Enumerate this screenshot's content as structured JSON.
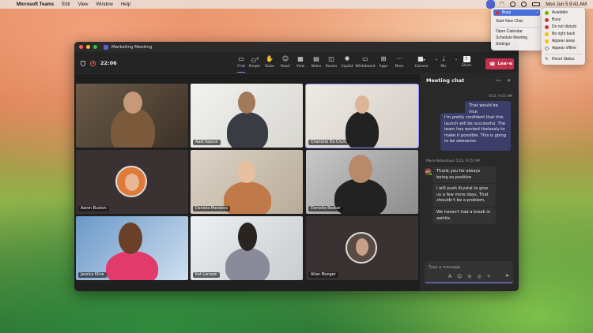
{
  "menubar": {
    "app": "Microsoft Teams",
    "items": [
      "Edit",
      "View",
      "Window",
      "Help"
    ],
    "clock": "Mon Jun 5  9:41 AM"
  },
  "window": {
    "title": "Marketing Meeting",
    "timer": "22:06"
  },
  "toolbar": {
    "buttons": [
      {
        "label": "Chat",
        "icon": "chat-icon",
        "glyph": "💬"
      },
      {
        "label": "People",
        "icon": "people-icon",
        "glyph": "👥",
        "badge": "9"
      },
      {
        "label": "Raise",
        "icon": "raise-hand-icon",
        "glyph": "✋"
      },
      {
        "label": "React",
        "icon": "react-icon",
        "glyph": "☺"
      },
      {
        "label": "View",
        "icon": "view-icon",
        "glyph": "▦"
      },
      {
        "label": "Notes",
        "icon": "notes-icon",
        "glyph": "▤"
      },
      {
        "label": "Rooms",
        "icon": "rooms-icon",
        "glyph": "◫"
      },
      {
        "label": "Copilot",
        "icon": "copilot-icon",
        "glyph": "✺"
      },
      {
        "label": "Whiteboard",
        "icon": "whiteboard-icon",
        "glyph": "▭"
      },
      {
        "label": "Apps",
        "icon": "apps-icon",
        "glyph": "⊞"
      },
      {
        "label": "More",
        "icon": "more-icon",
        "glyph": "···"
      },
      {
        "label": "Camera",
        "icon": "camera-icon",
        "glyph": "■"
      },
      {
        "label": "Mic",
        "icon": "mic-icon",
        "glyph": "🎙"
      },
      {
        "label": "Share",
        "icon": "share-icon",
        "glyph": "⇧"
      }
    ],
    "leave_label": "Leave"
  },
  "participants": [
    {
      "name": ""
    },
    {
      "name": "Aadi Kapoor"
    },
    {
      "name": "Charlotte De Crum"
    },
    {
      "name": "Aaron Buxton"
    },
    {
      "name": "Daniela Mandera"
    },
    {
      "name": "Danielle Booker"
    },
    {
      "name": "Jessica Kline"
    },
    {
      "name": "Kat Larsson"
    },
    {
      "name": "Allan Munger"
    }
  ],
  "chat": {
    "title": "Meeting chat",
    "messages": [
      {
        "timestamp": "5/12, 9:15 AM",
        "text": "That would be nice"
      },
      {
        "text": "I'm pretty confident that this launch will be successful. The team has worked tirelessly to make it possible. This is going to be awesome."
      },
      {
        "sender": "Marie Beaudouin",
        "timestamp": "5/12, 9:15 AM",
        "initials": "MB",
        "text": "Thank you for always being so positive"
      },
      {
        "text": "I will push Krystal to give us a few more days. That shouldn't be a problem."
      },
      {
        "text": "We haven't had a break in awhile."
      }
    ],
    "compose_placeholder": "Type a message"
  },
  "presence_menu": {
    "current": "Busy",
    "items": [
      "Start New Chat",
      "Open Calendar",
      "Schedule Meeting",
      "Settings"
    ]
  },
  "status_menu": {
    "options": [
      {
        "label": "Available",
        "color": "#6bb700"
      },
      {
        "label": "Busy",
        "color": "#d13438"
      },
      {
        "label": "Do not disturb",
        "color": "#d13438"
      },
      {
        "label": "Be right back",
        "color": "#f8c000"
      },
      {
        "label": "Appear away",
        "color": "#f8c000"
      },
      {
        "label": "Appear offline",
        "color": "#8a8886"
      }
    ],
    "reset_label": "Reset Status"
  },
  "colors": {
    "accent": "#5b5fc7",
    "leave": "#c4314b",
    "my_bubble": "#3b3e6b"
  }
}
